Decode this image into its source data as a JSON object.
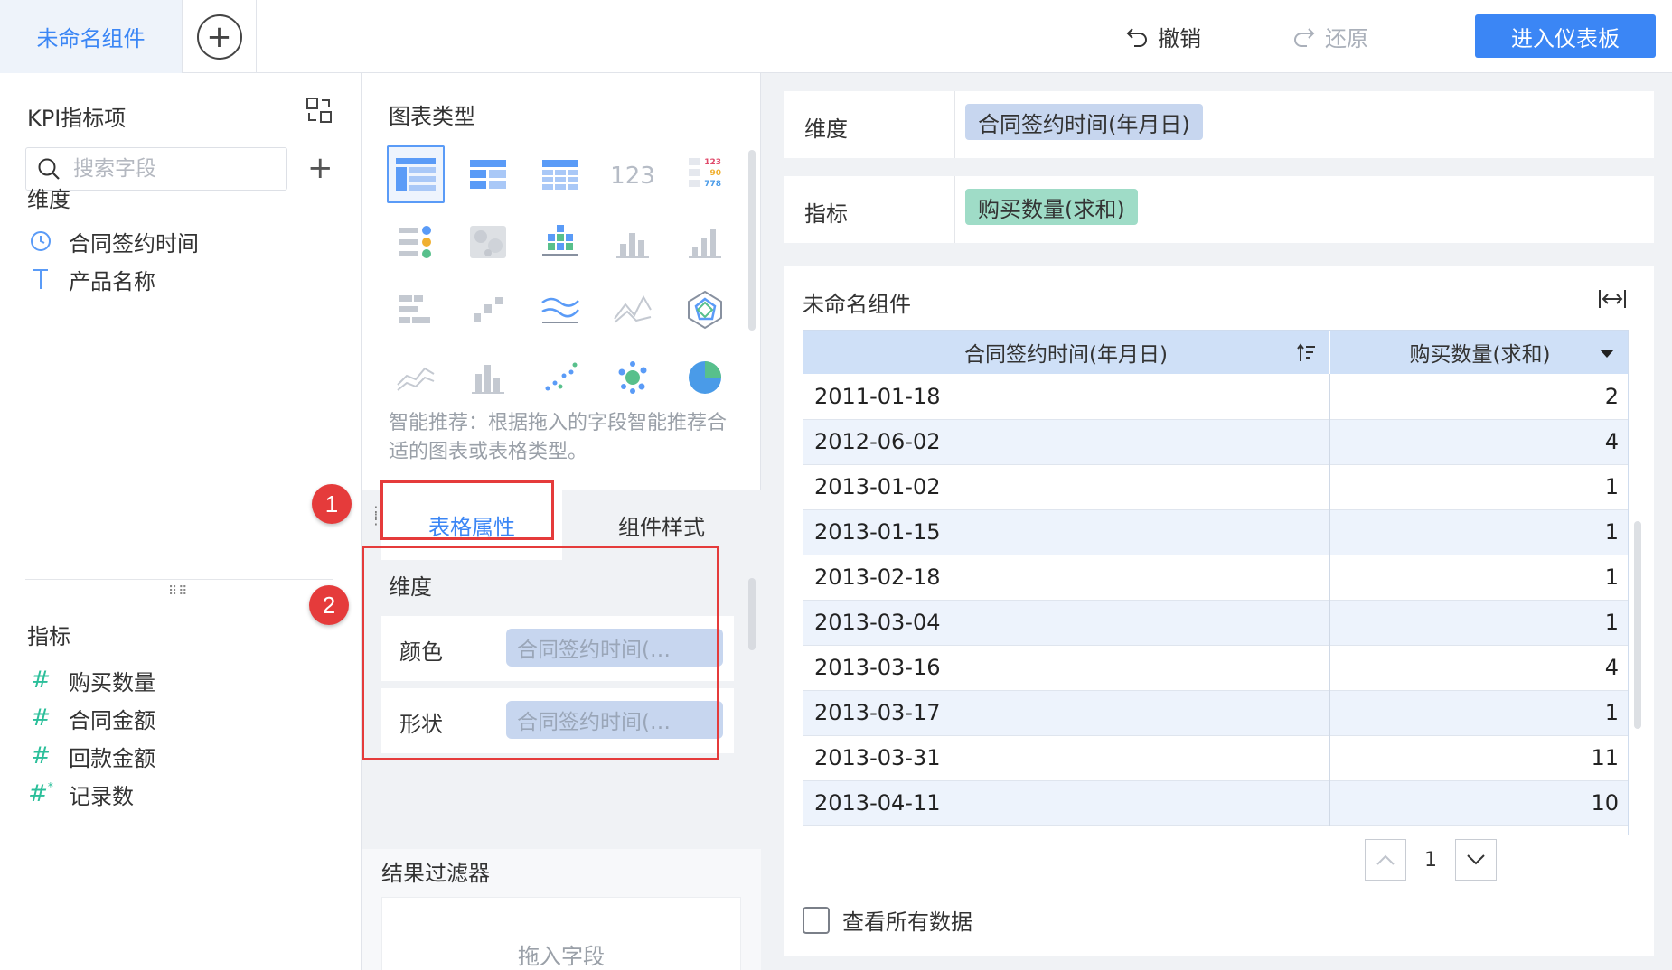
{
  "topbar": {
    "tab_label": "未命名组件",
    "undo_label": "撤销",
    "redo_label": "还原",
    "enter_dashboard_label": "进入仪表板"
  },
  "left": {
    "title": "KPI指标项",
    "search_placeholder": "搜索字段",
    "dimension_header": "维度",
    "dimensions": [
      {
        "label": "合同签约时间",
        "icon": "clock-icon"
      },
      {
        "label": "产品名称",
        "icon": "text-type-icon"
      }
    ],
    "measure_header": "指标",
    "measures": [
      {
        "label": "购买数量",
        "icon": "hash-icon"
      },
      {
        "label": "合同金额",
        "icon": "hash-icon"
      },
      {
        "label": "回款金额",
        "icon": "hash-icon"
      },
      {
        "label": "记录数",
        "icon": "hash-star-icon"
      }
    ]
  },
  "middle": {
    "chart_type_title": "图表类型",
    "hint": "智能推荐：根据拖入的字段智能推荐合适的图表或表格类型。",
    "number_chart_glyph": "123",
    "color_table_numbers": [
      "123",
      "90",
      "778"
    ],
    "tabs": {
      "active": "表格属性",
      "inactive": "组件样式"
    },
    "props": {
      "dimension_label": "维度",
      "color_label": "颜色",
      "color_value": "合同签约时间(…",
      "shape_label": "形状",
      "shape_value": "合同签约时间(…"
    },
    "filter_title": "结果过滤器",
    "filter_placeholder": "拖入字段"
  },
  "annotations": {
    "one": "1",
    "two": "2"
  },
  "right": {
    "dimension_label": "维度",
    "dimension_pill": "合同签约时间(年月日)",
    "measure_label": "指标",
    "measure_pill": "购买数量(求和)",
    "widget_title": "未命名组件",
    "table": {
      "headers": [
        "合同签约时间(年月日)",
        "购买数量(求和)"
      ],
      "rows": [
        [
          "2011-01-18",
          "2"
        ],
        [
          "2012-06-02",
          "4"
        ],
        [
          "2013-01-02",
          "1"
        ],
        [
          "2013-01-15",
          "1"
        ],
        [
          "2013-02-18",
          "1"
        ],
        [
          "2013-03-04",
          "1"
        ],
        [
          "2013-03-16",
          "4"
        ],
        [
          "2013-03-17",
          "1"
        ],
        [
          "2013-03-31",
          "11"
        ],
        [
          "2013-04-11",
          "10"
        ]
      ]
    },
    "page_number": "1",
    "see_all_label": "查看所有数据"
  },
  "colors": {
    "accent": "#3b86f5",
    "dimension_pill": "#c7d6ef",
    "measure_pill": "#9fdcc7",
    "annotation": "#e53b3b"
  }
}
